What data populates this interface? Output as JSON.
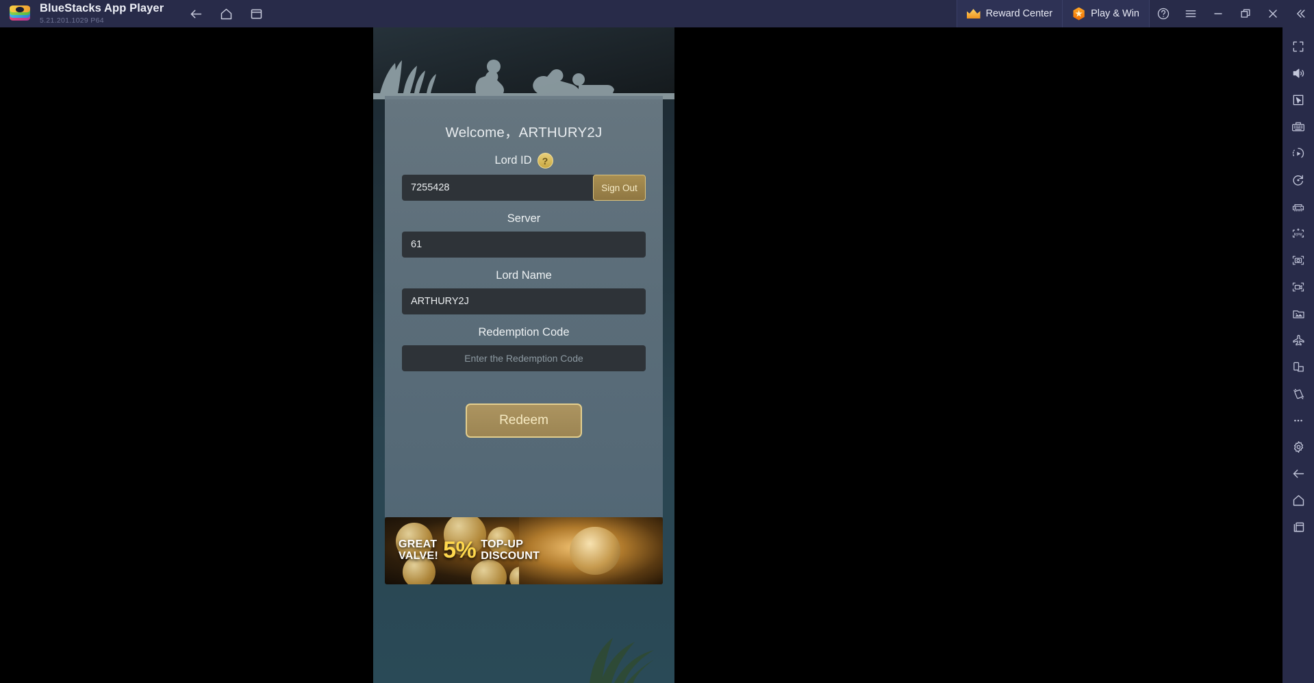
{
  "titlebar": {
    "app_name": "BlueStacks App Player",
    "version": "5.21.201.1029  P64",
    "logo_icon": "bluestacks-logo",
    "nav": [
      {
        "icon": "back-arrow-icon",
        "name": "back"
      },
      {
        "icon": "home-icon",
        "name": "home"
      },
      {
        "icon": "instance-manager-icon",
        "name": "instance-manager"
      }
    ],
    "reward_center": {
      "label": "Reward Center",
      "icon": "crown-icon"
    },
    "play_and_win": {
      "label": "Play & Win",
      "icon": "hex-star-icon"
    },
    "window_controls": [
      {
        "icon": "help-icon",
        "name": "help"
      },
      {
        "icon": "hamburger-menu-icon",
        "name": "menu"
      },
      {
        "icon": "minimize-icon",
        "name": "minimize"
      },
      {
        "icon": "restore-icon",
        "name": "restore"
      },
      {
        "icon": "close-icon",
        "name": "close"
      },
      {
        "icon": "collapse-chevrons-icon",
        "name": "collapse-sidebar"
      }
    ],
    "colors": {
      "bar_bg": "#282b49",
      "pill_bg": "#2e3255",
      "text": "#eef0f7",
      "version_text": "#6f7494"
    }
  },
  "game": {
    "welcome": "Welcome，ARTHURY2J",
    "lord_id": {
      "label": "Lord ID",
      "help_icon": "question-mark-icon",
      "value": "7255428",
      "sign_out_label": "Sign Out"
    },
    "server": {
      "label": "Server",
      "value": "61"
    },
    "lord_name": {
      "label": "Lord Name",
      "value": "ARTHURY2J"
    },
    "redemption_code": {
      "label": "Redemption Code",
      "placeholder": "Enter the Redemption Code",
      "value": ""
    },
    "redeem_label": "Redeem",
    "banner": {
      "line1": "GREAT",
      "line2": "VALVE!",
      "percent": "5%",
      "line3": "TOP-UP",
      "line4": "DISCOUNT"
    },
    "colors": {
      "panel": "#6c7c86",
      "input_bg": "#2e3338",
      "gold_border": "#e4cf8e",
      "gold_fill": "#ac9460",
      "percent_gold": "#ffd84d"
    }
  },
  "sidebar": {
    "items": [
      {
        "icon": "fullscreen-icon",
        "name": "fullscreen"
      },
      {
        "icon": "volume-icon",
        "name": "volume"
      },
      {
        "icon": "cursor-pointer-icon",
        "name": "cursor-mode"
      },
      {
        "icon": "keyboard-icon",
        "name": "game-controls"
      },
      {
        "icon": "macro-play-icon",
        "name": "macro-recorder"
      },
      {
        "icon": "rotate-icon",
        "name": "rotate"
      },
      {
        "icon": "gamepad-icon",
        "name": "gamepad"
      },
      {
        "icon": "apk-install-icon",
        "name": "install-apk"
      },
      {
        "icon": "screenshot-camera-icon",
        "name": "screenshot"
      },
      {
        "icon": "video-record-icon",
        "name": "record-screen"
      },
      {
        "icon": "media-folder-icon",
        "name": "media-manager"
      },
      {
        "icon": "airplane-icon",
        "name": "airplane-mode"
      },
      {
        "icon": "multi-instance-icon",
        "name": "multi-instance"
      },
      {
        "icon": "shake-tilt-icon",
        "name": "shake"
      },
      {
        "icon": "more-dots-icon",
        "name": "more"
      },
      {
        "icon": "gear-icon",
        "name": "settings"
      },
      {
        "icon": "back-arrow-icon",
        "name": "android-back"
      },
      {
        "icon": "home-icon",
        "name": "android-home"
      },
      {
        "icon": "recent-apps-icon",
        "name": "android-recents"
      }
    ]
  }
}
